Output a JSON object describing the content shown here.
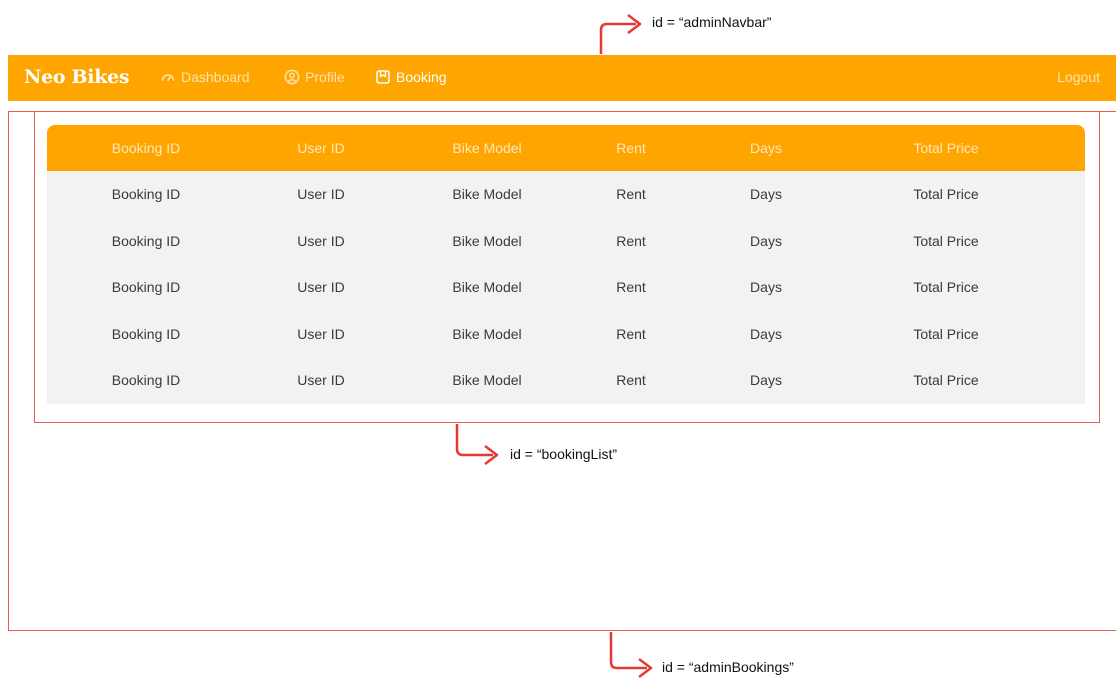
{
  "annotations": {
    "navbar_id": "id = “adminNavbar”",
    "list_id": "id = “bookingList”",
    "page_id": "id = “adminBookings”",
    "arrow_color": "#E53935"
  },
  "navbar": {
    "brand": "Neo Bikes",
    "items": [
      {
        "label": "Dashboard",
        "icon": "gauge-icon"
      },
      {
        "label": "Profile",
        "icon": "user-circle-icon"
      },
      {
        "label": "Booking",
        "icon": "bookmark-box-icon"
      }
    ],
    "logout": "Logout",
    "color": "#FFA500"
  },
  "table": {
    "headers": [
      "Booking ID",
      "User ID",
      "Bike Model",
      "Rent",
      "Days",
      "Total Price"
    ],
    "rows": [
      [
        "Booking ID",
        "User ID",
        "Bike Model",
        "Rent",
        "Days",
        "Total Price"
      ],
      [
        "Booking ID",
        "User ID",
        "Bike Model",
        "Rent",
        "Days",
        "Total Price"
      ],
      [
        "Booking ID",
        "User ID",
        "Bike Model",
        "Rent",
        "Days",
        "Total Price"
      ],
      [
        "Booking ID",
        "User ID",
        "Bike Model",
        "Rent",
        "Days",
        "Total Price"
      ],
      [
        "Booking ID",
        "User ID",
        "Bike Model",
        "Rent",
        "Days",
        "Total Price"
      ]
    ]
  }
}
